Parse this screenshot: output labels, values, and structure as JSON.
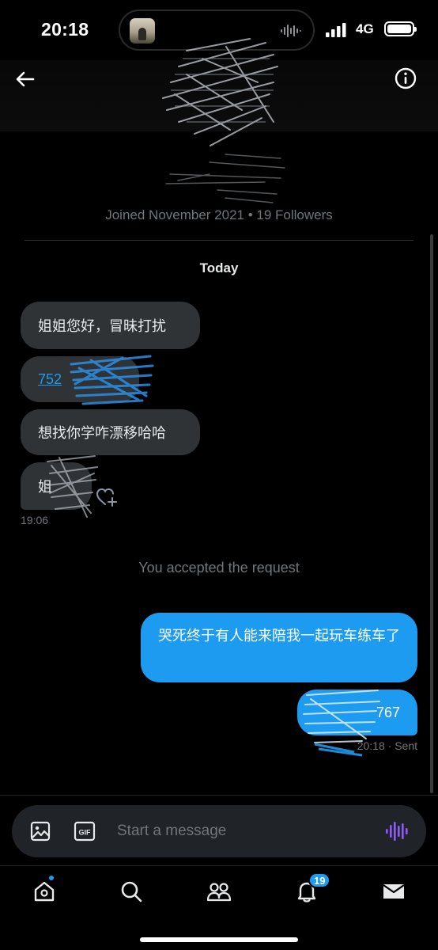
{
  "status_bar": {
    "time": "20:18",
    "network": "4G"
  },
  "header": {
    "back_icon": "arrow-left-icon",
    "info_icon": "info-circle-icon"
  },
  "profile": {
    "joined_text": "Joined November 2021 • 19 Followers"
  },
  "conversation": {
    "day_label": "Today",
    "incoming": [
      {
        "text": "姐姐您好，冒昧打扰"
      },
      {
        "text": "752",
        "is_link": true
      },
      {
        "text": "想找你学咋漂移哈哈"
      },
      {
        "text": "姐"
      }
    ],
    "incoming_time": "19:06",
    "system_note": "You accepted the request",
    "outgoing": [
      {
        "text": "哭死终于有人能来陪我一起玩车练车了"
      },
      {
        "text": "767"
      }
    ],
    "sent_meta": "20:18 · Sent"
  },
  "composer": {
    "placeholder": "Start a message",
    "image_icon": "image-icon",
    "gif_label": "GIF",
    "voice_icon": "voice-wave-icon"
  },
  "bottom_nav": {
    "items": [
      "home",
      "search",
      "communities",
      "notifications",
      "messages"
    ],
    "notification_count": "19"
  },
  "colors": {
    "accent": "#1d9bf0",
    "incoming_bubble": "#2f3336",
    "muted_text": "#71767b",
    "voice_purple": "#8b5cf6"
  }
}
